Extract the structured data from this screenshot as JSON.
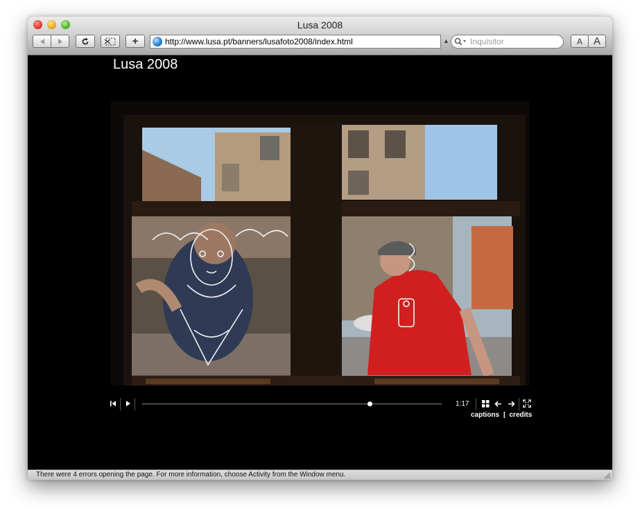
{
  "window": {
    "title": "Lusa 2008"
  },
  "toolbar": {
    "back_icon": "left-arrow-icon",
    "forward_icon": "right-arrow-icon",
    "reload_icon": "reload-icon",
    "snippet_icon": "webclip-icon",
    "add_bookmark_label": "+",
    "address": "http://www.lusa.pt/banners/lusafoto2008/index.html",
    "search_placeholder": "Inquisitor",
    "text_smaller_label": "A",
    "text_larger_label": "A"
  },
  "page": {
    "heading": "Lusa 2008",
    "slideshow": {
      "elapsed_time": "1:17",
      "progress_fraction": 0.76,
      "captions_label": "captions",
      "separator": "|",
      "credits_label": "credits"
    }
  },
  "status": {
    "message": "There were 4 errors opening the page. For more information, choose Activity from the Window menu."
  }
}
